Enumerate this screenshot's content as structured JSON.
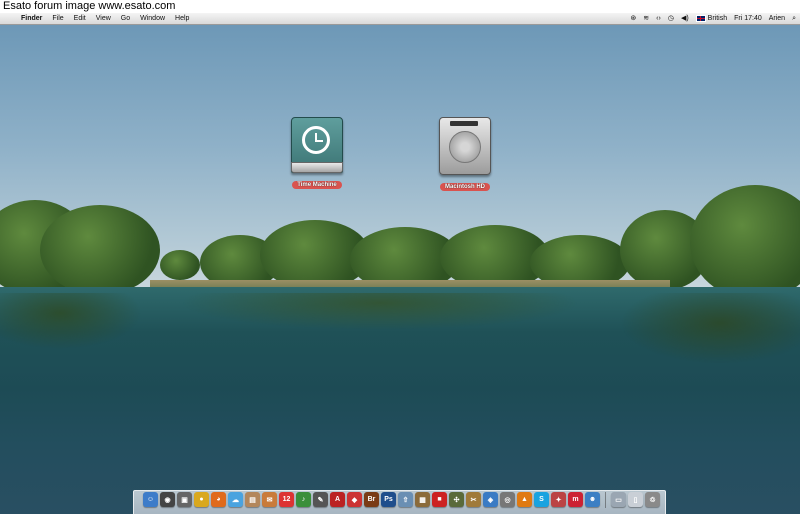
{
  "watermark": "Esato forum image www.esato.com",
  "menubar": {
    "apple_icon": "apple-icon",
    "app_name": "Finder",
    "menus": [
      "File",
      "Edit",
      "View",
      "Go",
      "Window",
      "Help"
    ],
    "status": {
      "input_source": "British",
      "clock": "Fri 17:40",
      "user": "Arien"
    }
  },
  "desktop": {
    "volumes": [
      {
        "label": "Time Machine",
        "icon": "time-machine-disk-icon"
      },
      {
        "label": "Macintosh HD",
        "icon": "hard-disk-icon"
      }
    ]
  },
  "dock": {
    "items": [
      {
        "name": "finder",
        "glyph": "☺",
        "color": "#3d7cc9"
      },
      {
        "name": "dashboard",
        "glyph": "◉",
        "color": "#444"
      },
      {
        "name": "expose",
        "glyph": "▣",
        "color": "#666"
      },
      {
        "name": "chrome",
        "glyph": "●",
        "color": "#d9a81e"
      },
      {
        "name": "firefox",
        "glyph": "◕",
        "color": "#e06a1b"
      },
      {
        "name": "ichat",
        "glyph": "☁",
        "color": "#4aa3df"
      },
      {
        "name": "preview",
        "glyph": "▤",
        "color": "#b3875c"
      },
      {
        "name": "mail-stamp",
        "glyph": "✉",
        "color": "#c97b3a"
      },
      {
        "name": "ical",
        "glyph": "12",
        "color": "#d33"
      },
      {
        "name": "itunes",
        "glyph": "♪",
        "color": "#3a8f3a"
      },
      {
        "name": "script-editor",
        "glyph": "✎",
        "color": "#555"
      },
      {
        "name": "acrobat",
        "glyph": "A",
        "color": "#b22"
      },
      {
        "name": "ical-red",
        "glyph": "◆",
        "color": "#c33"
      },
      {
        "name": "bridge",
        "glyph": "Br",
        "color": "#7a3b16"
      },
      {
        "name": "photoshop",
        "glyph": "Ps",
        "color": "#1f4e8c"
      },
      {
        "name": "uploader",
        "glyph": "⇧",
        "color": "#6a8fb3"
      },
      {
        "name": "photo-app",
        "glyph": "▦",
        "color": "#8b6b3a"
      },
      {
        "name": "photobooth",
        "glyph": "■",
        "color": "#c22"
      },
      {
        "name": "network-tool",
        "glyph": "✣",
        "color": "#5a6a3a"
      },
      {
        "name": "utility-tool",
        "glyph": "✂",
        "color": "#a07a3a"
      },
      {
        "name": "app-store",
        "glyph": "◈",
        "color": "#3a7bc4"
      },
      {
        "name": "disk-utility",
        "glyph": "◎",
        "color": "#777"
      },
      {
        "name": "vlc",
        "glyph": "▲",
        "color": "#e07a12"
      },
      {
        "name": "skype",
        "glyph": "S",
        "color": "#1aa3e0"
      },
      {
        "name": "reeder",
        "glyph": "✦",
        "color": "#b44"
      },
      {
        "name": "mint",
        "glyph": "m",
        "color": "#c23"
      },
      {
        "name": "contacts",
        "glyph": "☻",
        "color": "#3b7fc4"
      },
      {
        "name": "downloads",
        "glyph": "▭",
        "color": "#9aa6b2"
      },
      {
        "name": "documents",
        "glyph": "▯",
        "color": "#c9cfd6"
      },
      {
        "name": "trash",
        "glyph": "♲",
        "color": "#8a8a8a"
      }
    ]
  }
}
